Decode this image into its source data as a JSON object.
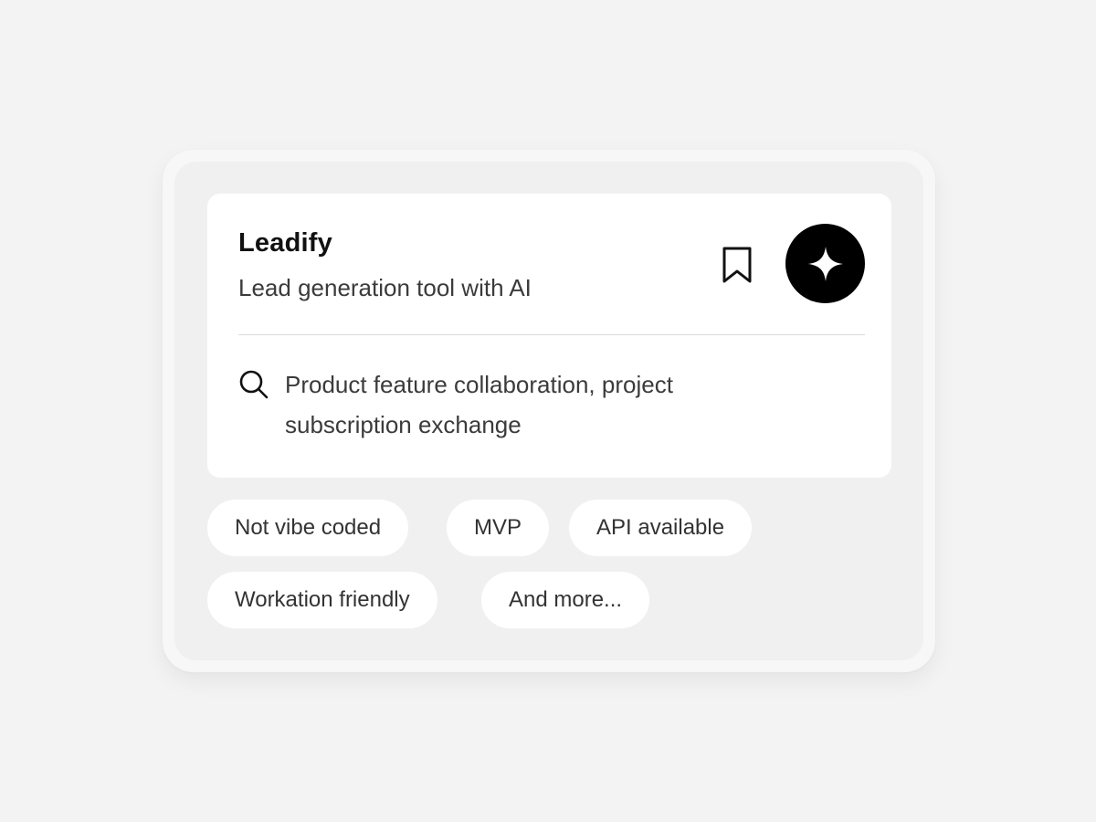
{
  "card": {
    "title": "Leadify",
    "subtitle": "Lead generation tool with AI",
    "bookmark_icon": "bookmark-icon",
    "ai_icon": "sparkle-icon",
    "search_icon": "search-icon",
    "query": "Product feature collaboration, project subscription exchange"
  },
  "tags": [
    {
      "label": "Not vibe coded"
    },
    {
      "label": "MVP"
    },
    {
      "label": "API available"
    },
    {
      "label": "Workation friendly"
    },
    {
      "label": "And more..."
    }
  ],
  "colors": {
    "background": "#f3f3f3",
    "panel": "#ffffff",
    "accent_button": "#000000",
    "text_primary": "#111111",
    "text_secondary": "#3b3b3b"
  }
}
